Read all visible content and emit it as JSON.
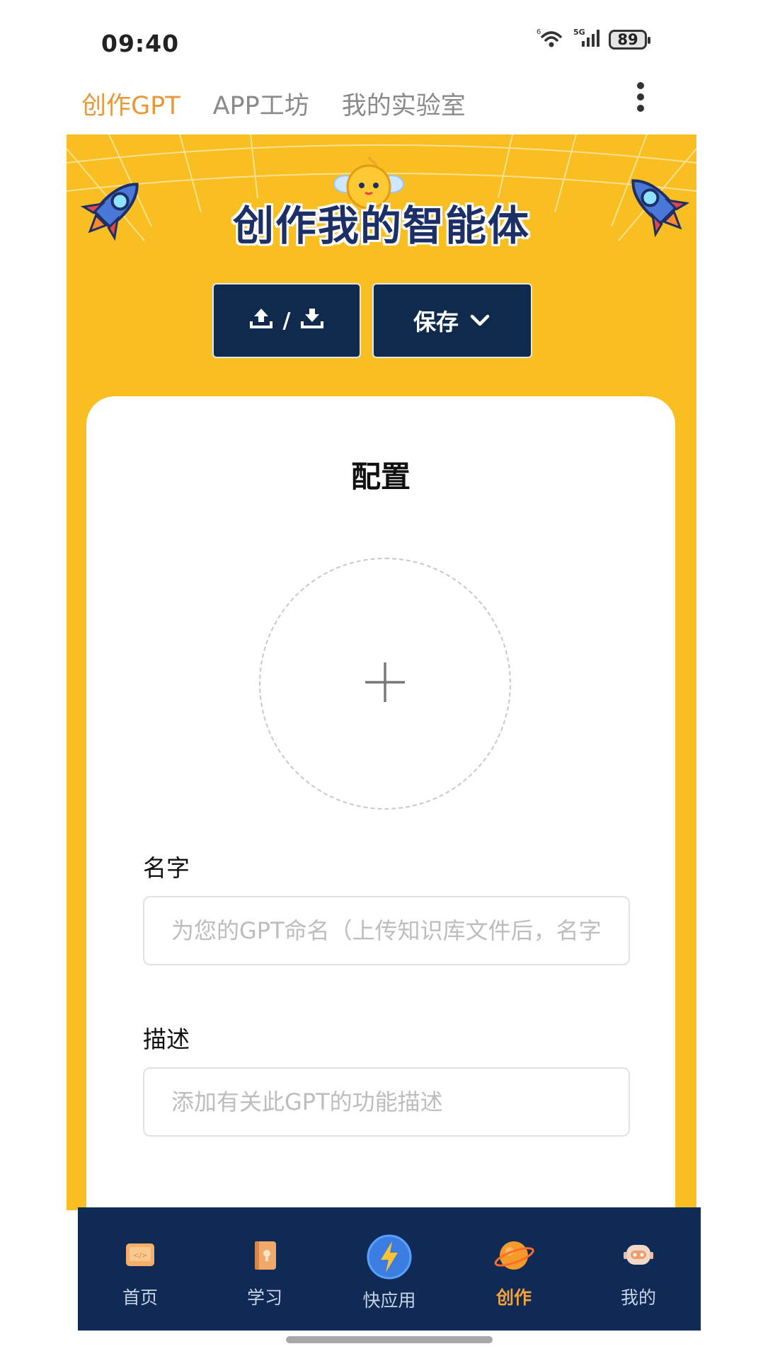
{
  "status_bar": {
    "time": "09:40",
    "network": "5G",
    "wifi_badge": "6",
    "battery": "89"
  },
  "top_tabs": [
    {
      "label": "创作GPT",
      "active": true
    },
    {
      "label": "APP工坊",
      "active": false
    },
    {
      "label": "我的实验室",
      "active": false
    }
  ],
  "banner": {
    "title": "创作我的智能体"
  },
  "toolbar": {
    "upload_download_separator": "/",
    "save_label": "保存"
  },
  "config": {
    "title": "配置",
    "name_label": "名字",
    "name_placeholder": "为您的GPT命名（上传知识库文件后，名字",
    "desc_label": "描述",
    "desc_placeholder": "添加有关此GPT的功能描述"
  },
  "bottom_nav": [
    {
      "label": "首页",
      "icon": "home-icon",
      "active": false
    },
    {
      "label": "学习",
      "icon": "book-icon",
      "active": false
    },
    {
      "label": "快应用",
      "icon": "lightning-icon",
      "active": false
    },
    {
      "label": "创作",
      "icon": "planet-icon",
      "active": true
    },
    {
      "label": "我的",
      "icon": "robot-avatar-icon",
      "active": false
    }
  ],
  "colors": {
    "accent_tab": "#e8983a",
    "panel_yellow": "#f8be22",
    "dark_navy": "#102a4e",
    "nav_active": "#f2a33a"
  }
}
